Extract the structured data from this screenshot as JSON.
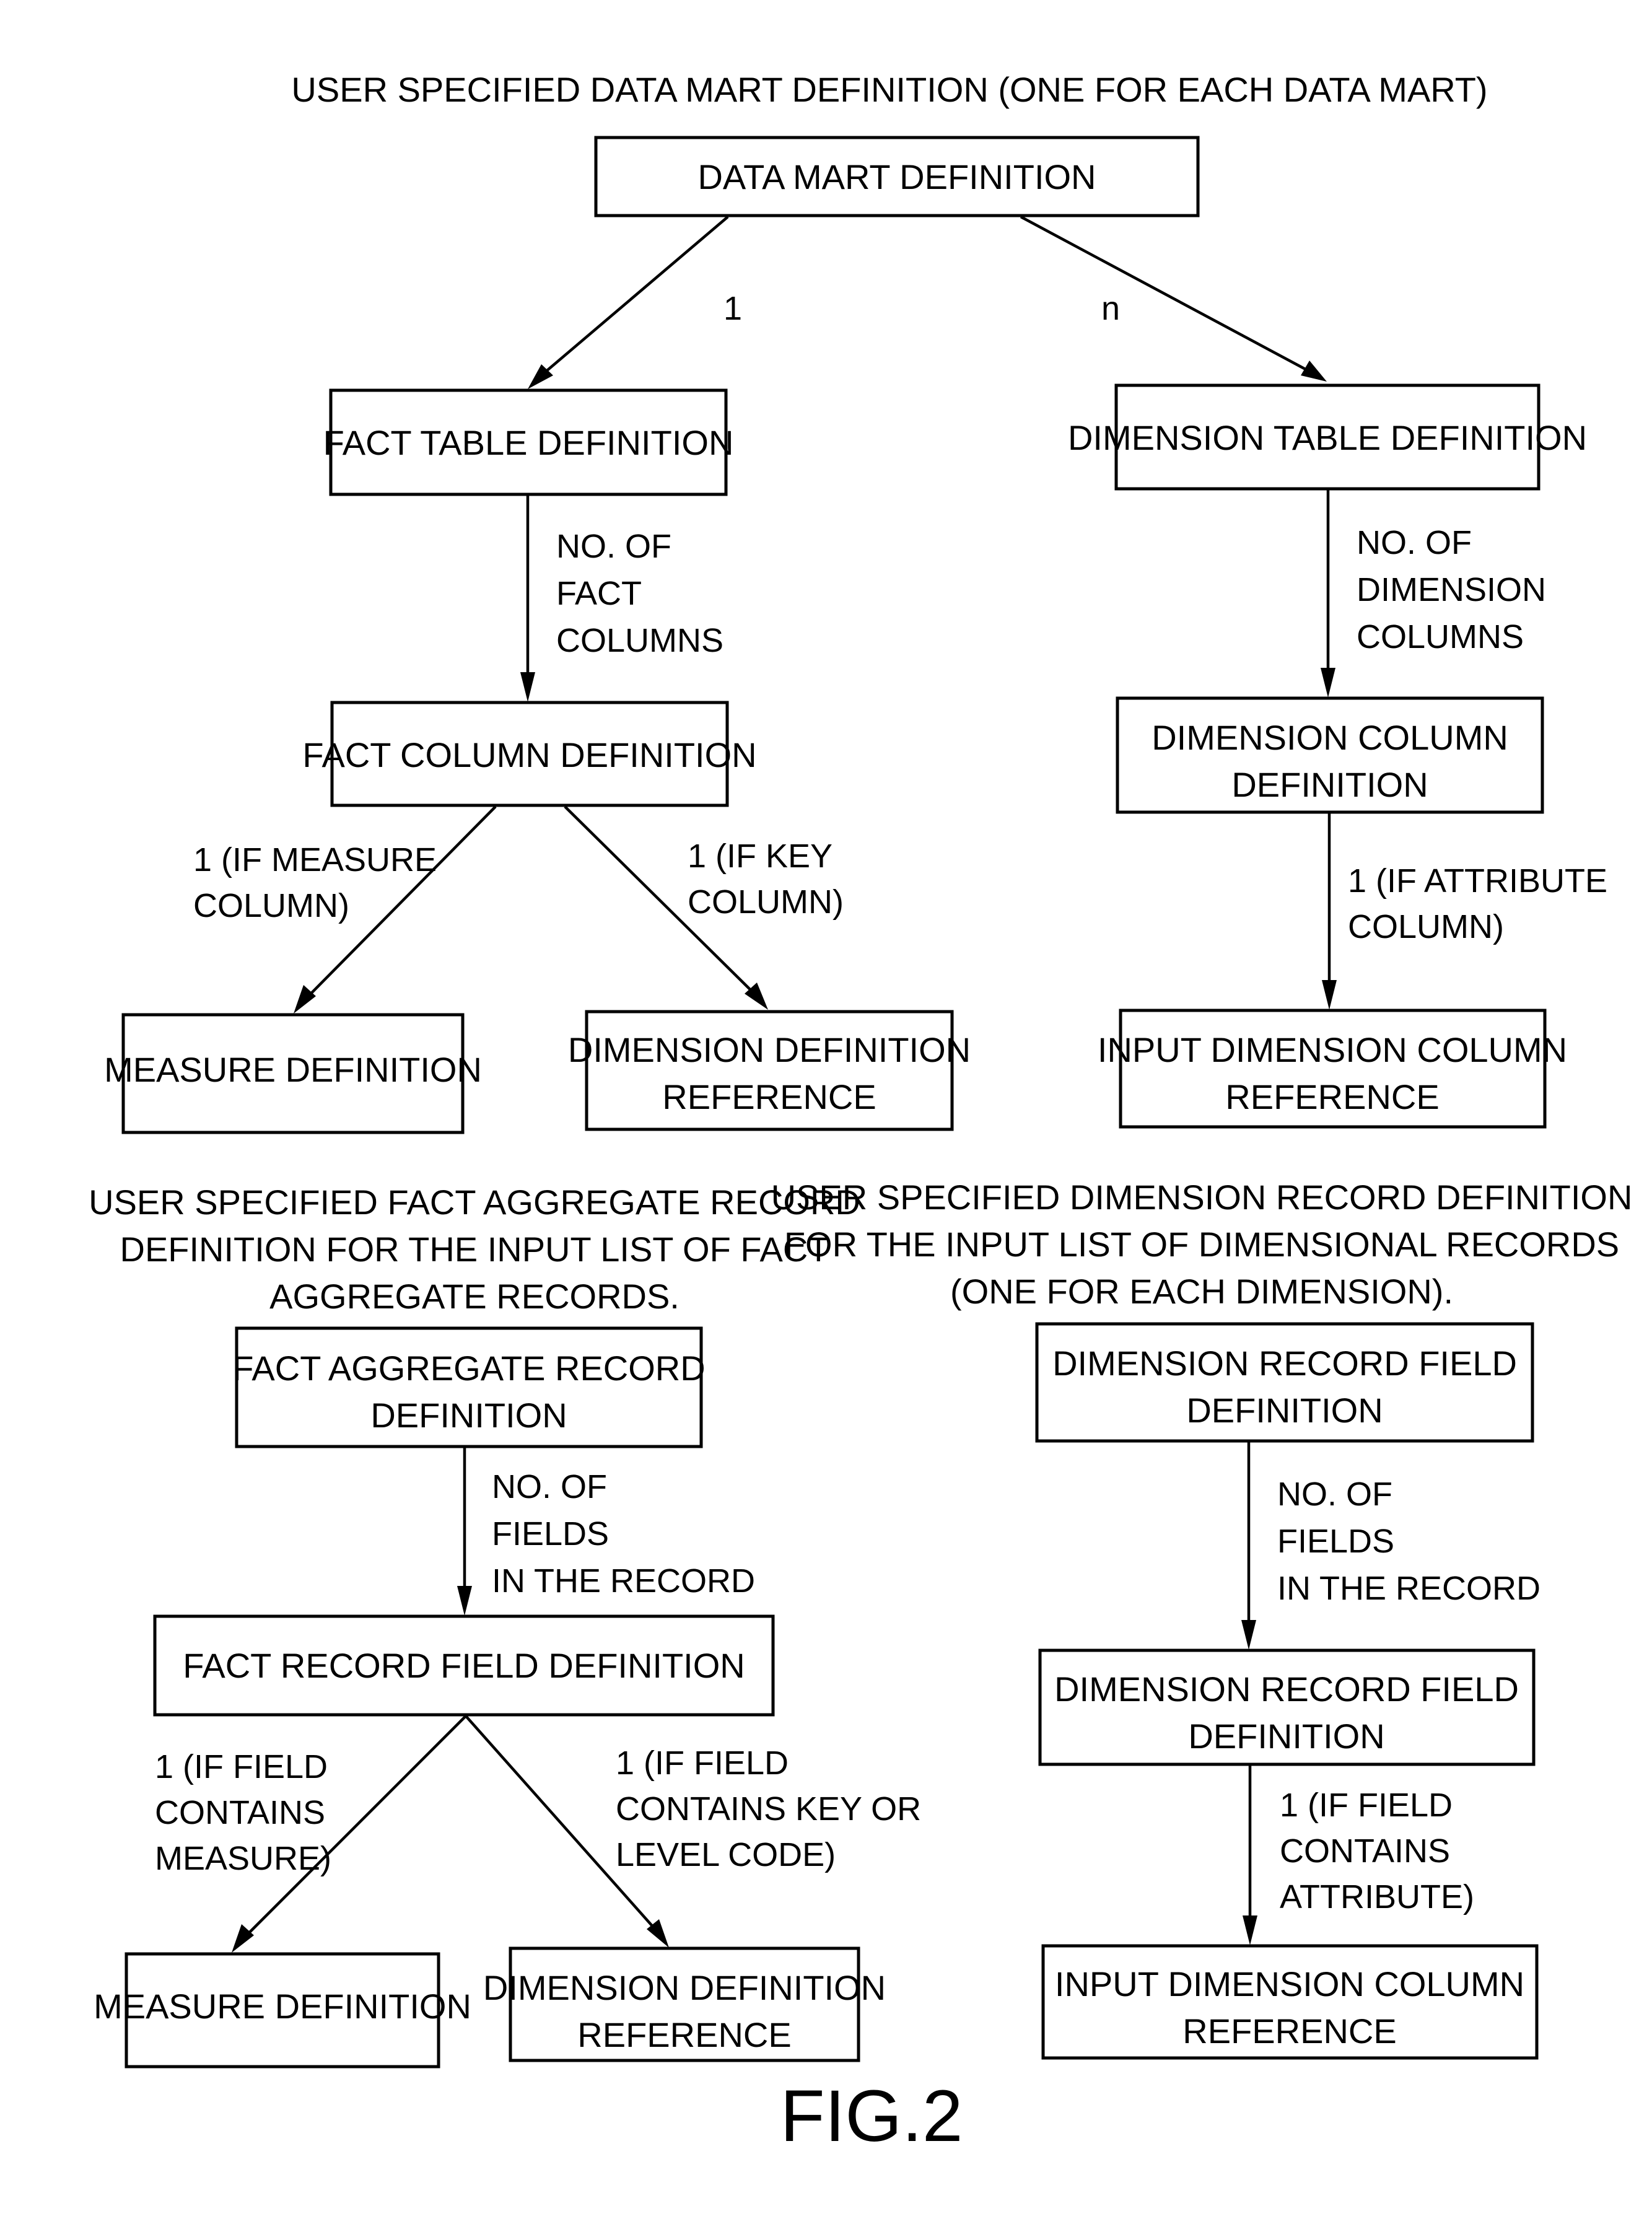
{
  "figure_label": "FIG.2",
  "sections": {
    "data_mart": {
      "caption": [
        "USER SPECIFIED DATA MART DEFINITION (ONE FOR EACH DATA MART)"
      ],
      "nodes": {
        "data_mart_definition": [
          "DATA MART DEFINITION"
        ],
        "fact_table_definition": [
          "FACT TABLE DEFINITION"
        ],
        "dimension_table_definition": [
          "DIMENSION TABLE DEFINITION"
        ],
        "fact_column_definition": [
          "FACT COLUMN DEFINITION"
        ],
        "dimension_column_definition": [
          "DIMENSION COLUMN",
          "DEFINITION"
        ],
        "measure_definition": [
          "MEASURE DEFINITION"
        ],
        "dimension_definition_reference": [
          "DIMENSION DEFINITION",
          "REFERENCE"
        ],
        "input_dimension_column_reference": [
          "INPUT DIMENSION COLUMN",
          "REFERENCE"
        ]
      },
      "edges": {
        "to_fact_table": [
          "1"
        ],
        "to_dimension_table": [
          "n"
        ],
        "to_fact_column": [
          "NO. OF",
          "FACT",
          "COLUMNS"
        ],
        "to_dimension_column": [
          "NO. OF",
          "DIMENSION",
          "COLUMNS"
        ],
        "to_measure": [
          "1 (IF MEASURE",
          "COLUMN)"
        ],
        "to_dimension_reference": [
          "1 (IF KEY",
          "COLUMN)"
        ],
        "to_input_dimension_column": [
          "1 (IF ATTRIBUTE",
          "COLUMN)"
        ]
      }
    },
    "fact_aggregate": {
      "caption": [
        "USER SPECIFIED FACT AGGREGATE RECORD",
        "DEFINITION FOR THE INPUT LIST OF FACT",
        "AGGREGATE RECORDS."
      ],
      "nodes": {
        "fact_aggregate_record_definition": [
          "FACT AGGREGATE RECORD",
          "DEFINITION"
        ],
        "fact_record_field_definition": [
          "FACT RECORD FIELD DEFINITION"
        ],
        "measure_definition": [
          "MEASURE DEFINITION"
        ],
        "dimension_definition_reference": [
          "DIMENSION DEFINITION",
          "REFERENCE"
        ]
      },
      "edges": {
        "to_fact_record_field": [
          "NO. OF",
          "FIELDS",
          "IN THE RECORD"
        ],
        "to_measure": [
          "1 (IF FIELD",
          "CONTAINS",
          "MEASURE)"
        ],
        "to_dimension_reference": [
          "1 (IF FIELD",
          "CONTAINS KEY OR",
          "LEVEL CODE)"
        ]
      }
    },
    "dimension_record": {
      "caption": [
        "USER SPECIFIED DIMENSION RECORD DEFINITION",
        "FOR THE INPUT LIST OF DIMENSIONAL RECORDS",
        "(ONE FOR EACH DIMENSION)."
      ],
      "nodes": {
        "dimension_record_field_definition_top": [
          "DIMENSION RECORD FIELD",
          "DEFINITION"
        ],
        "dimension_record_field_definition": [
          "DIMENSION RECORD FIELD",
          "DEFINITION"
        ],
        "input_dimension_column_reference": [
          "INPUT DIMENSION COLUMN",
          "REFERENCE"
        ]
      },
      "edges": {
        "to_dimension_record_field": [
          "NO. OF",
          "FIELDS",
          "IN THE RECORD"
        ],
        "to_input_dimension_column": [
          "1 (IF FIELD",
          "CONTAINS",
          "ATTRIBUTE)"
        ]
      }
    }
  }
}
